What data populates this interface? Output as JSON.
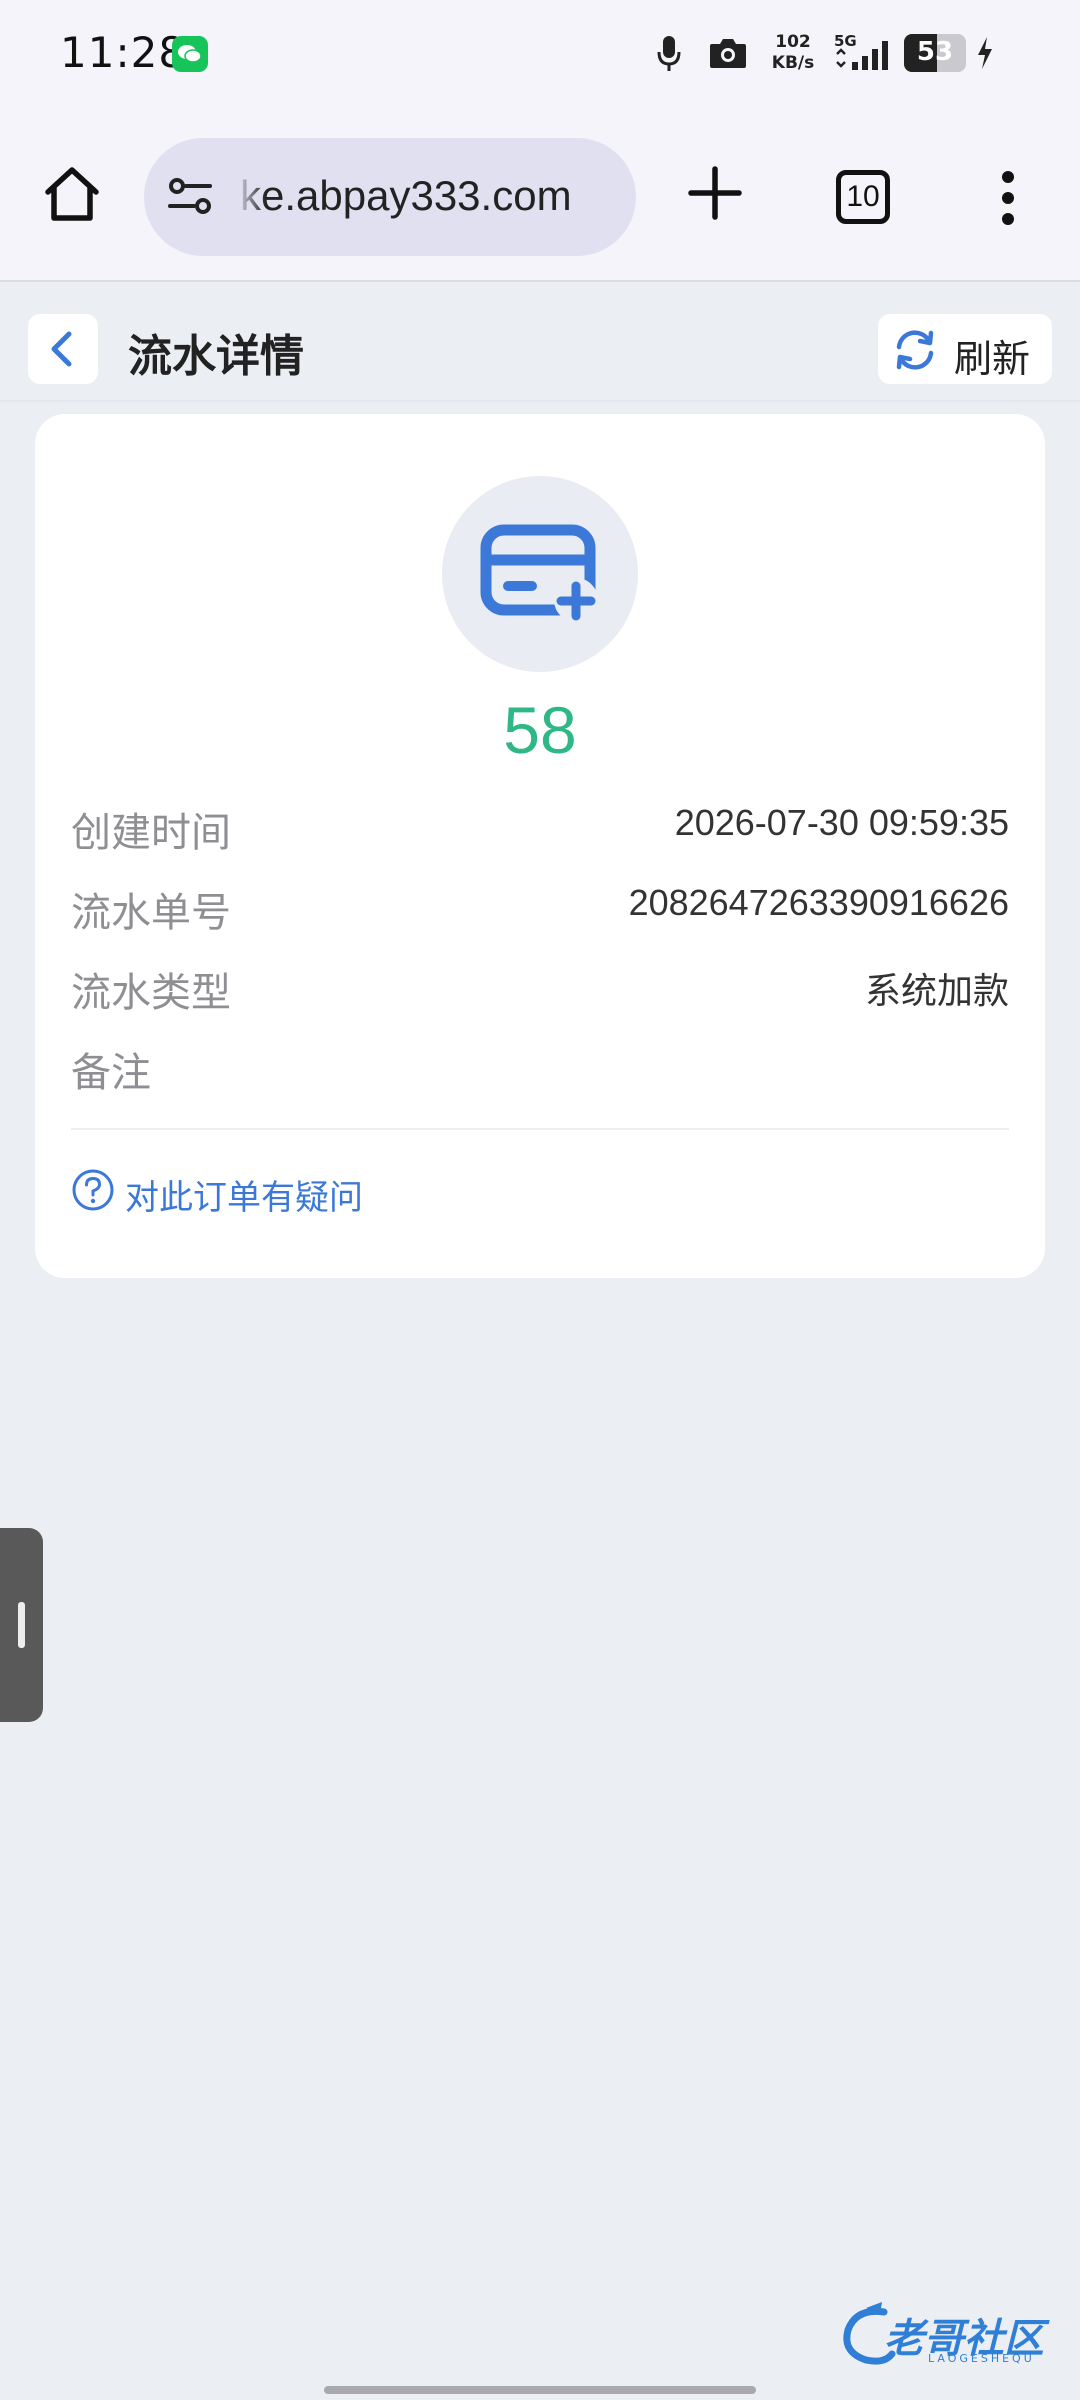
{
  "status_bar": {
    "time": "11:28",
    "net_speed_value": "102",
    "net_speed_unit": "KB/s",
    "network": "5G",
    "battery_percent": 53,
    "battery_text": "53",
    "charging": true
  },
  "browser": {
    "url": "ke.abpay333.com",
    "tab_count": "10"
  },
  "header": {
    "title": "流水详情",
    "refresh_label": "刷新"
  },
  "detail": {
    "amount": "58",
    "rows": [
      {
        "label": "创建时间",
        "value": "2026-07-30 09:59:35"
      },
      {
        "label": "流水单号",
        "value": "2082647263390916626"
      },
      {
        "label": "流水类型",
        "value": "系统加款"
      },
      {
        "label": "备注",
        "value": ""
      }
    ],
    "question_link": "对此订单有疑问"
  },
  "watermark": {
    "text": "老哥社区",
    "sub": "LAOGESHEQU"
  },
  "colors": {
    "accent_blue": "#3b78d8",
    "amount_green": "#2fb885",
    "background": "#ebeff4"
  }
}
